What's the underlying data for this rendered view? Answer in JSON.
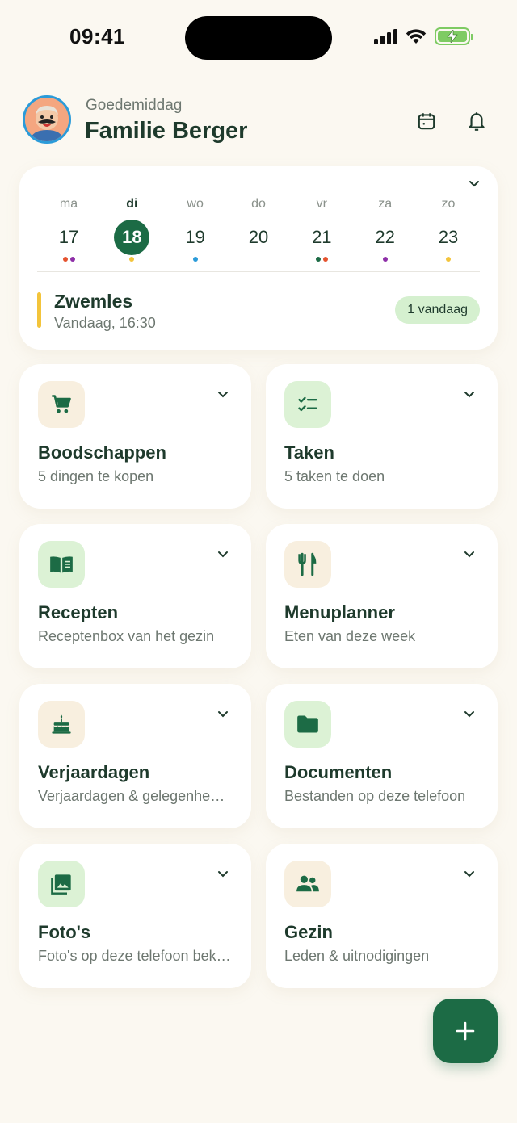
{
  "status_bar": {
    "time": "09:41"
  },
  "header": {
    "greeting": "Goedemiddag",
    "family_name": "Familie Berger",
    "calendar_icon": "calendar-icon",
    "bell_icon": "bell-icon"
  },
  "calendar": {
    "days": [
      {
        "label": "ma",
        "num": "17",
        "dots": [
          "#e5532f",
          "#8e2fa8"
        ],
        "active": false
      },
      {
        "label": "di",
        "num": "18",
        "dots": [
          "#f3c43b"
        ],
        "active": true
      },
      {
        "label": "wo",
        "num": "19",
        "dots": [
          "#2b9bd9"
        ],
        "active": false
      },
      {
        "label": "do",
        "num": "20",
        "dots": [],
        "active": false
      },
      {
        "label": "vr",
        "num": "21",
        "dots": [
          "#1c6b45",
          "#e5532f"
        ],
        "active": false
      },
      {
        "label": "za",
        "num": "22",
        "dots": [
          "#8e2fa8"
        ],
        "active": false
      },
      {
        "label": "zo",
        "num": "23",
        "dots": [
          "#f3c43b"
        ],
        "active": false
      }
    ],
    "event": {
      "title": "Zwemles",
      "time": "Vandaag, 16:30",
      "color": "#f3c43b"
    },
    "today_badge": "1 vandaag"
  },
  "tiles": [
    {
      "id": "boodschappen",
      "title": "Boodschappen",
      "subtitle": "5 dingen te kopen",
      "icon": "cart-icon",
      "bg": "#f8efdf"
    },
    {
      "id": "taken",
      "title": "Taken",
      "subtitle": "5 taken te doen",
      "icon": "checklist-icon",
      "bg": "#dcf2d5"
    },
    {
      "id": "recepten",
      "title": "Recepten",
      "subtitle": "Receptenbox van het gezin",
      "icon": "book-icon",
      "bg": "#dcf2d5"
    },
    {
      "id": "menuplanner",
      "title": "Menuplanner",
      "subtitle": "Eten van deze week",
      "icon": "utensils-icon",
      "bg": "#f8efdf"
    },
    {
      "id": "verjaardagen",
      "title": "Verjaardagen",
      "subtitle": "Verjaardagen & gelegenheden",
      "icon": "cake-icon",
      "bg": "#f8efdf"
    },
    {
      "id": "documenten",
      "title": "Documenten",
      "subtitle": "Bestanden op deze telefoon",
      "icon": "folder-icon",
      "bg": "#dcf2d5"
    },
    {
      "id": "fotos",
      "title": "Foto's",
      "subtitle": "Foto's op deze telefoon bekijken",
      "icon": "photos-icon",
      "bg": "#dcf2d5"
    },
    {
      "id": "gezin",
      "title": "Gezin",
      "subtitle": "Leden & uitnodigingen",
      "icon": "people-icon",
      "bg": "#f8efdf"
    }
  ],
  "fab": {
    "icon": "plus-icon"
  },
  "colors": {
    "primary": "#1c6b45",
    "background": "#fbf8f1",
    "text": "#1e3a2c",
    "muted": "#6d7770"
  }
}
